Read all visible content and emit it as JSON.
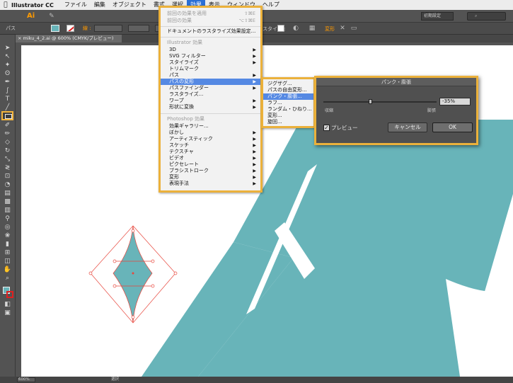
{
  "menubar": {
    "apple": "",
    "app_name": "Illustrator CC",
    "items": [
      "ファイル",
      "編集",
      "オブジェクト",
      "書式",
      "選択",
      "効果",
      "表示",
      "ウィンドウ",
      "ヘルプ"
    ]
  },
  "appbar": {
    "logo": "Ai",
    "workspace": "初期設定",
    "search_placeholder": ""
  },
  "controlbar": {
    "selection_type": "パス",
    "stroke_label": "線 :",
    "style_label": "スタイル :",
    "transform_label": "変形"
  },
  "document": {
    "tab_title": "miku_4_2.ai @ 600% (CMYK/プレビュー)",
    "zoom": "600%",
    "current_tool": "選択"
  },
  "effect_menu": {
    "apply_last": "前回の効果を適用",
    "apply_last_shortcut": "⇧⌘E",
    "last_effect": "前回の効果",
    "last_effect_shortcut": "⌥⇧⌘E",
    "rasterize_settings": "ドキュメントのラスタライズ効果設定...",
    "illustrator_header": "Illustrator 効果",
    "illustrator_items": [
      "3D",
      "SVG フィルター",
      "スタイライズ",
      "トリムマーク",
      "パス",
      "パスの変形",
      "パスファインダー",
      "ラスタライズ...",
      "ワープ",
      "形状に変換"
    ],
    "photoshop_header": "Photoshop 効果",
    "photoshop_items": [
      "効果ギャラリー...",
      "ぼかし",
      "アーティスティック",
      "スケッチ",
      "テクスチャ",
      "ビデオ",
      "ピクセレート",
      "ブラシストローク",
      "変形",
      "表現手法"
    ]
  },
  "warp_submenu": {
    "items": [
      "ジグザグ...",
      "パスの自由変形...",
      "パンク・膨張...",
      "ラフ...",
      "ランダム・ひねり...",
      "変形...",
      "旋回..."
    ]
  },
  "pucker_dialog": {
    "title": "パンク・膨張",
    "value_text": "-35%",
    "value": -35,
    "min": -200,
    "max": 200,
    "left_label": "収縮",
    "right_label": "膨張",
    "preview_label": "プレビュー",
    "preview_checked": true,
    "cancel_label": "キャンセル",
    "ok_label": "OK"
  },
  "colors": {
    "accent_highlight": "#ebb13b",
    "menu_selection": "#5589e3",
    "artwork_teal": "#68b4b9",
    "selection_path": "#e8463c"
  }
}
